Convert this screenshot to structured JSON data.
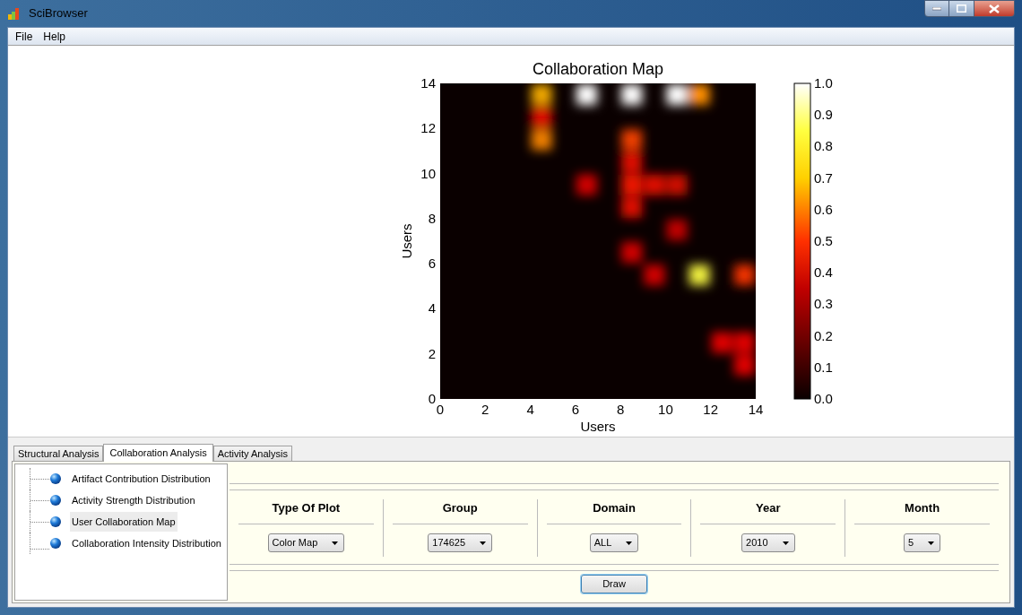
{
  "window": {
    "title": "SciBrowser"
  },
  "menu": [
    {
      "label": "File"
    },
    {
      "label": "Help"
    }
  ],
  "plot": {
    "title": "Collaboration Map",
    "xlabel": "Users",
    "ylabel": "Users",
    "xticks": [
      "0",
      "2",
      "4",
      "6",
      "8",
      "10",
      "12",
      "14"
    ],
    "yticks": [
      "14",
      "12",
      "10",
      "8",
      "6",
      "4",
      "2",
      "0"
    ],
    "colorbar_ticks": [
      "1.0",
      "0.9",
      "0.8",
      "0.7",
      "0.6",
      "0.5",
      "0.4",
      "0.3",
      "0.2",
      "0.1",
      "0.0"
    ]
  },
  "tabs": [
    {
      "label": "Structural Analysis",
      "selected": false
    },
    {
      "label": "Collaboration Analysis",
      "selected": true
    },
    {
      "label": "Activity Analysis",
      "selected": false
    }
  ],
  "tree": [
    {
      "label": "Artifact Contribution Distribution",
      "selected": false
    },
    {
      "label": "Activity Strength Distribution",
      "selected": false
    },
    {
      "label": "User Collaboration Map",
      "selected": true
    },
    {
      "label": "Collaboration Intensity Distribution",
      "selected": false
    }
  ],
  "options": [
    {
      "label": "Type Of Plot",
      "value": "Color Map"
    },
    {
      "label": "Group",
      "value": "174625"
    },
    {
      "label": "Domain",
      "value": "ALL"
    },
    {
      "label": "Year",
      "value": "2010"
    },
    {
      "label": "Month",
      "value": "5"
    }
  ],
  "draw_button": "Draw"
}
